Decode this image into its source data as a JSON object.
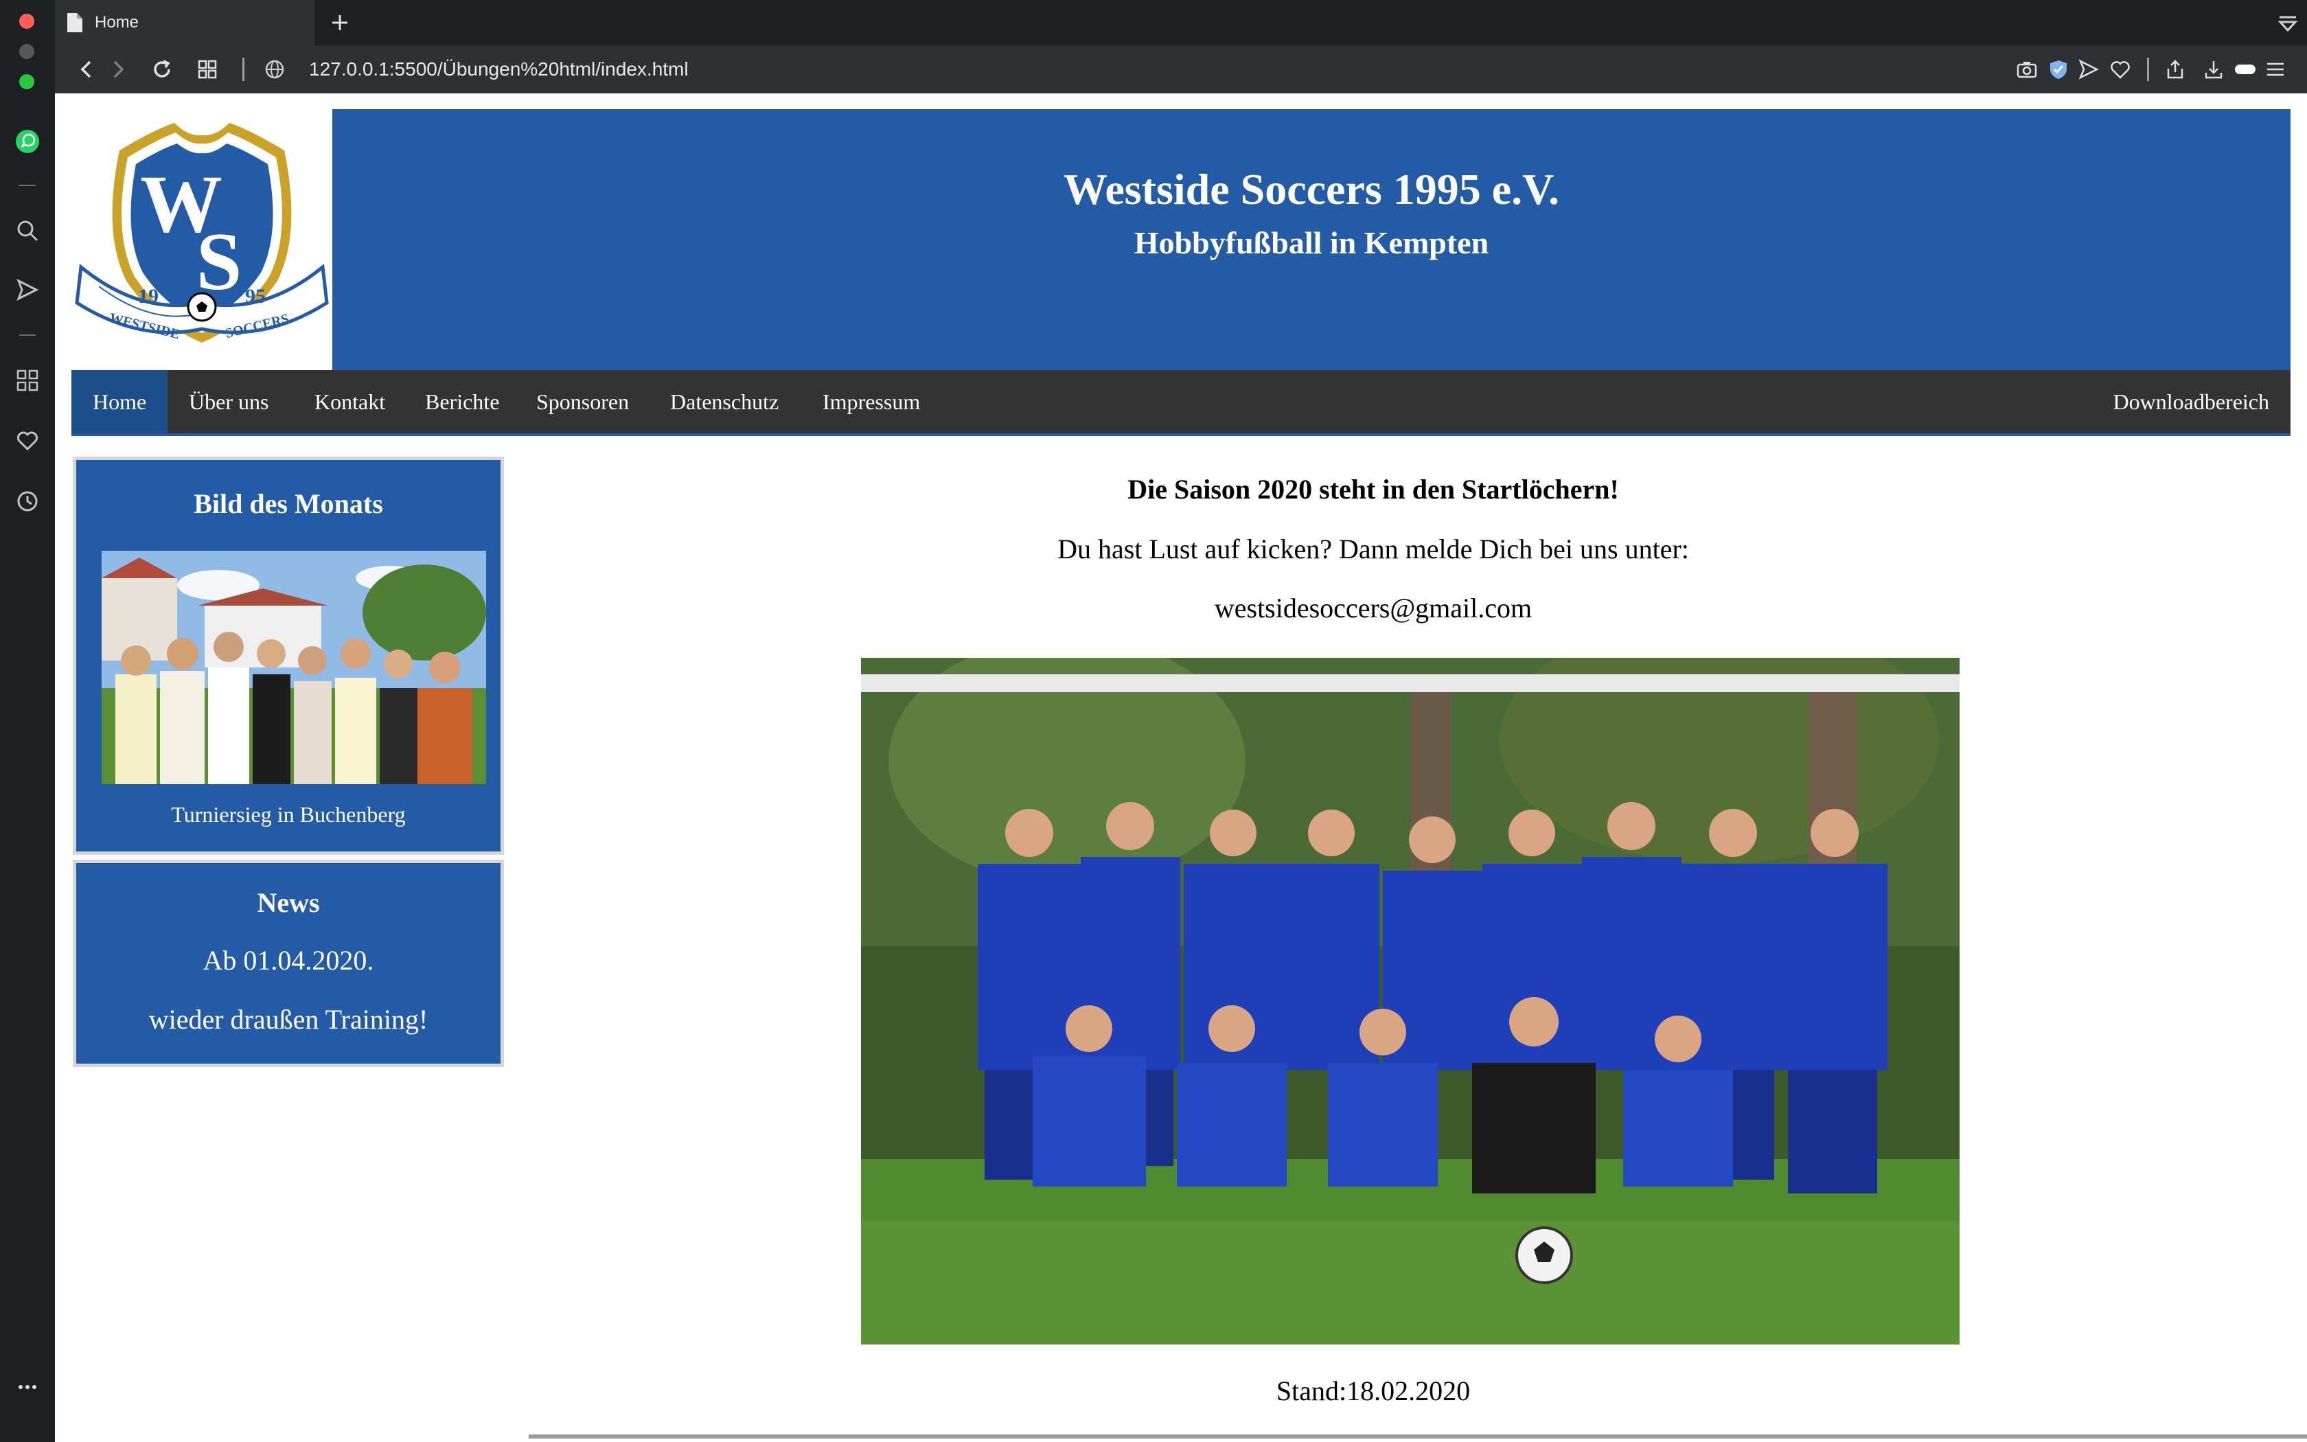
{
  "browser": {
    "tab_title": "Home",
    "url": "127.0.0.1:5500/Übungen%20html/index.html"
  },
  "site": {
    "title": "Westside Soccers 1995 e.V.",
    "subtitle": "Hobbyfußball in Kempten",
    "logo": {
      "letters": "WS",
      "year_left": "19",
      "year_right": "95",
      "ribbon_left": "WESTSIDE",
      "ribbon_right": "SOCCERS"
    }
  },
  "nav": {
    "items": [
      "Home",
      "Über uns",
      "Kontakt",
      "Berichte",
      "Sponsoren",
      "Datenschutz",
      "Impressum"
    ],
    "right_item": "Downloadbereich",
    "active": "Home"
  },
  "sidebar": {
    "picture_of_month": {
      "title": "Bild des Monats",
      "caption": "Turniersieg in Buchenberg"
    },
    "news": {
      "title": "News",
      "line1": "Ab 01.04.2020.",
      "line2": "wieder draußen Training!"
    }
  },
  "main": {
    "headline": "Die Saison 2020 steht in den Startlöchern!",
    "invite": "Du hast Lust auf kicken? Dann melde Dich bei uns unter:",
    "email": "westsidesoccers@gmail.com",
    "stand": "Stand:18.02.2020"
  },
  "colors": {
    "club_blue": "#235ba6",
    "nav_bg": "#333333",
    "nav_active": "#1c4e8a",
    "logo_gold": "#c9a227"
  }
}
